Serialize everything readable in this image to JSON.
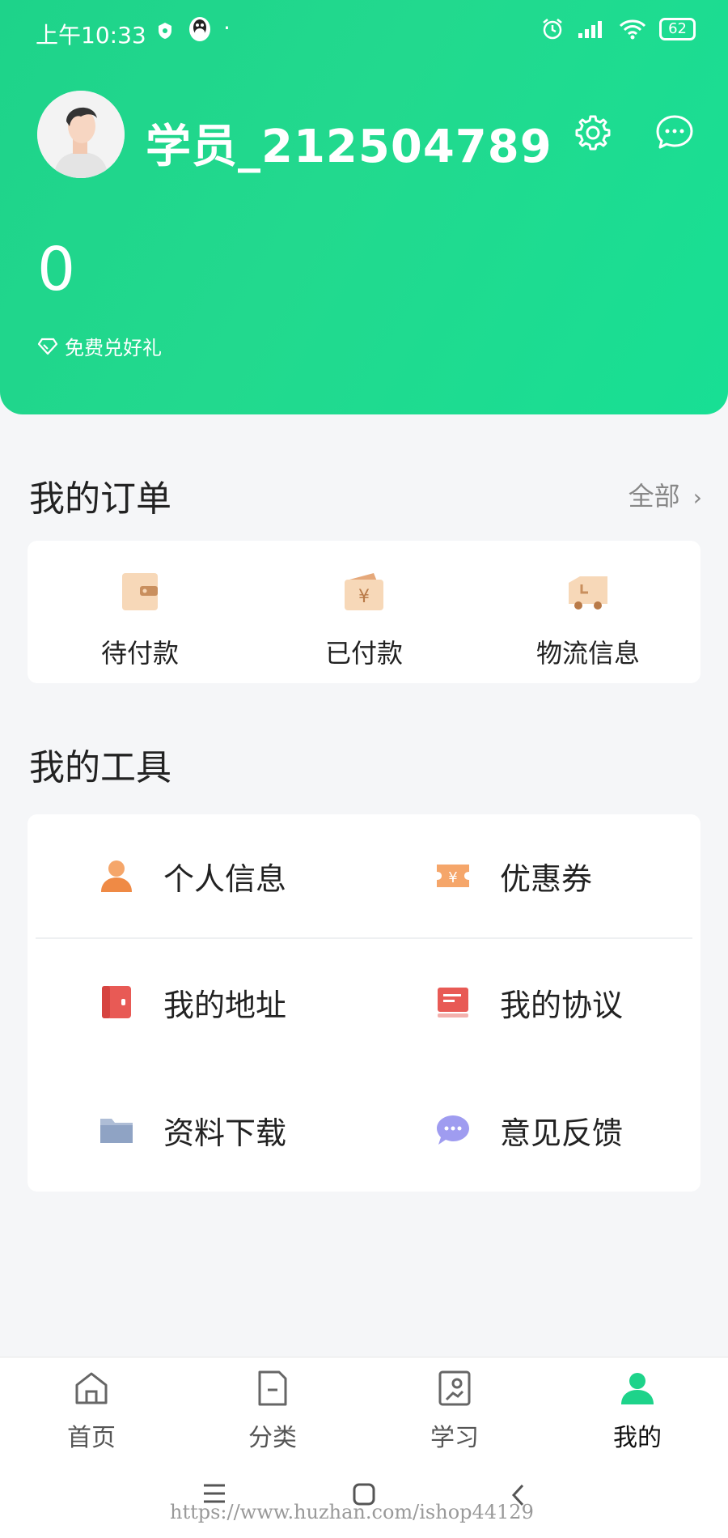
{
  "status_bar": {
    "time": "上午10:33",
    "battery": "62"
  },
  "profile": {
    "username": "学员_212504789",
    "points": "0",
    "redeem_label": "免费兑好礼",
    "settings_icon": "gear-icon",
    "message_icon": "chat-bubble-icon"
  },
  "orders": {
    "title": "我的订单",
    "all_label": "全部",
    "items": [
      {
        "label": "待付款",
        "icon": "wallet-icon"
      },
      {
        "label": "已付款",
        "icon": "yuan-wallet-icon"
      },
      {
        "label": "物流信息",
        "icon": "truck-icon"
      }
    ]
  },
  "tools": {
    "title": "我的工具",
    "items": [
      {
        "label": "个人信息",
        "icon": "person-icon"
      },
      {
        "label": "优惠券",
        "icon": "coupon-icon"
      },
      {
        "label": "我的地址",
        "icon": "address-book-icon"
      },
      {
        "label": "我的协议",
        "icon": "agreement-icon"
      },
      {
        "label": "资料下载",
        "icon": "folder-icon"
      },
      {
        "label": "意见反馈",
        "icon": "feedback-bubble-icon"
      }
    ]
  },
  "tabbar": {
    "items": [
      {
        "label": "首页",
        "icon": "home-icon"
      },
      {
        "label": "分类",
        "icon": "category-doc-icon"
      },
      {
        "label": "学习",
        "icon": "study-icon"
      },
      {
        "label": "我的",
        "icon": "profile-icon",
        "active": true
      }
    ]
  },
  "watermark": "https://www.huzhan.com/ishop44129",
  "colors": {
    "accent": "#1ed38a",
    "background": "#f5f6f8",
    "muted": "#888888"
  }
}
